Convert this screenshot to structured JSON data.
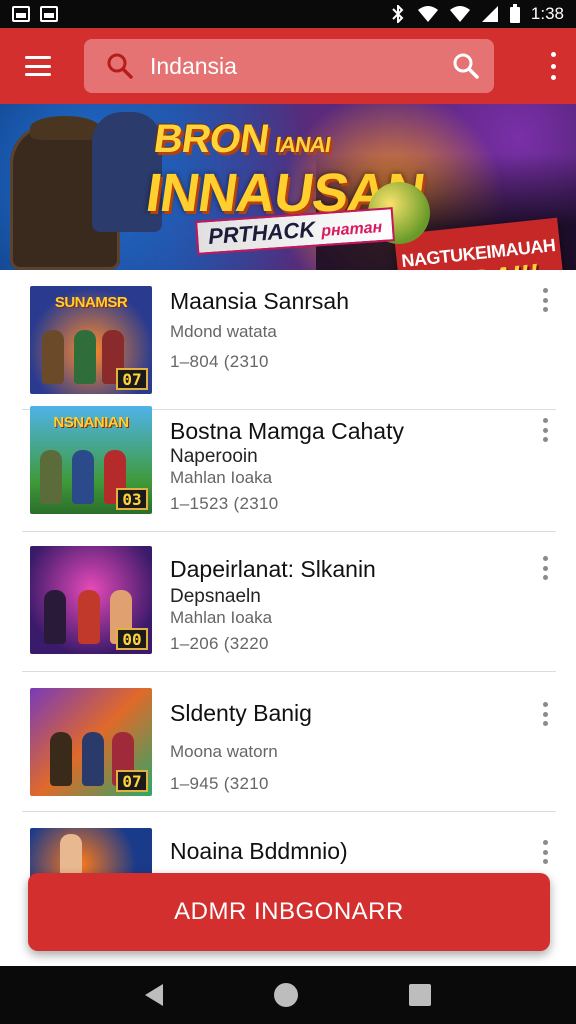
{
  "status_bar": {
    "time": "1:38"
  },
  "app_bar": {
    "search_value": "Indansia",
    "lead_icon": "search-icon",
    "trail_icon": "search-icon",
    "menu_icon": "hamburger-menu-icon",
    "overflow_icon": "more-vert-icon"
  },
  "banner": {
    "title_line1": "BRON",
    "title_line1_small": "IANAI",
    "title_line2": "INNAUSAN",
    "subtitle": "PRTHACK",
    "subtitle_small": "рнатан",
    "promo_line1": "NAGTUKEIMAUAH",
    "promo_line2": "ISODAI!!"
  },
  "items": [
    {
      "title": "Maansia Sanrsah",
      "subtitle": "",
      "meta": "Mdond watata",
      "stat": "1–804 (2310",
      "badge": "07",
      "thumb_title": "SUNAMSR"
    },
    {
      "title": "Bostna Mamga Cahaty",
      "subtitle": "Naperooin",
      "meta": "Mahlan Ioaka",
      "stat": "1–1523 (2310",
      "badge": "03",
      "thumb_title": "NSNANIAN"
    },
    {
      "title": "Dapeirlanat: Slkanin",
      "subtitle": "Depsnaeln",
      "meta": "Mahlan Ioaka",
      "stat": "1–206 (3220",
      "badge": "00",
      "thumb_title": ""
    },
    {
      "title": "Sldenty Banig",
      "subtitle": "",
      "meta": "Moona watorn",
      "stat": "1–945 (3210",
      "badge": "07",
      "thumb_title": ""
    },
    {
      "title": "Noaina Bddmnio)",
      "subtitle": "",
      "meta": "",
      "stat": "",
      "badge": "",
      "thumb_title": ""
    }
  ],
  "cta_label": "ADMR INBGONARR",
  "nav": {
    "back_icon": "back-icon",
    "home_icon": "home-icon",
    "recents_icon": "recents-icon"
  },
  "colors": {
    "primary": "#d32f2f",
    "search_bg": "#e57373",
    "badge_border": "#e3b23c"
  }
}
